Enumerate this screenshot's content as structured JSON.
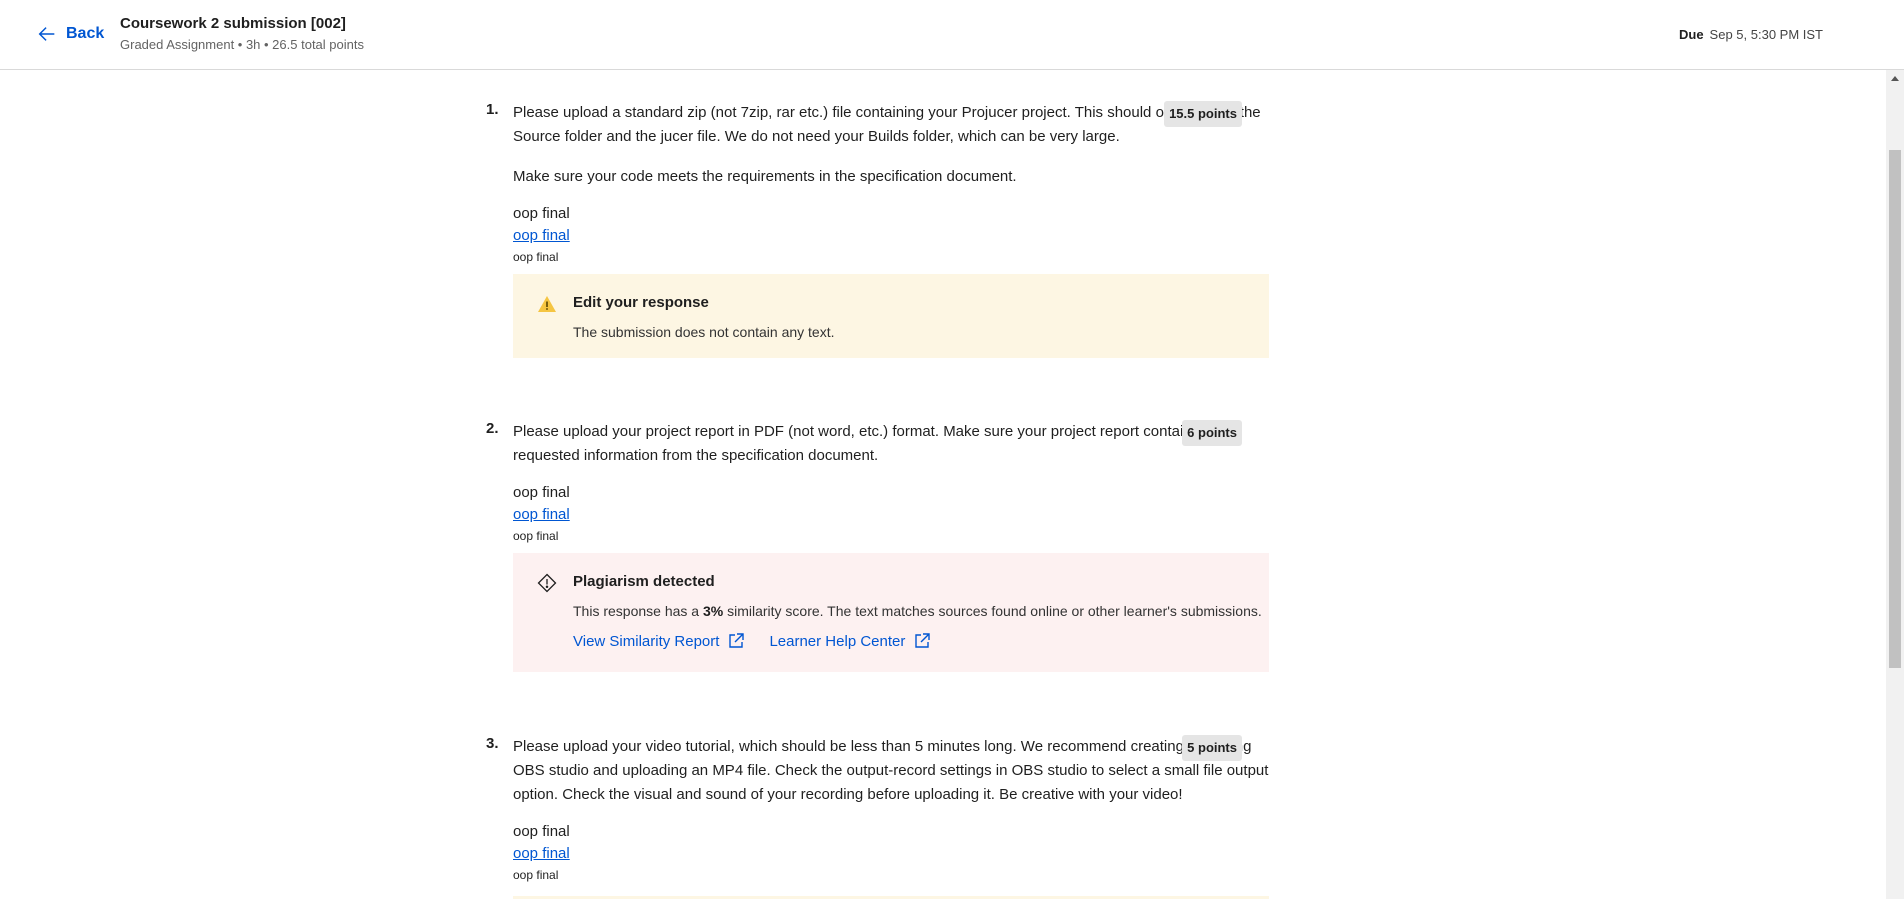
{
  "header": {
    "back_label": "Back",
    "title": "Coursework 2 submission [002]",
    "subtitle": "Graded Assignment • 3h • 26.5 total points",
    "due_label": "Due",
    "due_value": "Sep 5, 5:30 PM IST"
  },
  "questions": [
    {
      "number": "1.",
      "text": "Please upload a standard zip (not 7zip, rar etc.) file containing your Projucer project. This should only contain the Source folder and the jucer file. We do not need your Builds folder, which can be very large.",
      "extra": "Make sure your code meets the requirements in the specification document.",
      "points": "15.5 points",
      "file_name": "oop final",
      "file_link": "oop final",
      "file_small": "oop final",
      "alert": {
        "type": "warning",
        "icon": "warning-icon",
        "title": "Edit your response",
        "message": "The submission does not contain any text."
      }
    },
    {
      "number": "2.",
      "text": "Please upload your project report in PDF (not word, etc.) format. Make sure your project report contains the requested information from the specification document.",
      "points": "6 points",
      "file_name": "oop final",
      "file_link": "oop final",
      "file_small": "oop final",
      "alert": {
        "type": "plagiarism",
        "icon": "alert-diamond-icon",
        "title": "Plagiarism detected",
        "message_prefix": "This response has a ",
        "message_score": "3%",
        "message_suffix": " similarity score. The text matches sources found online or other learner's submissions.",
        "link1": "View Similarity Report",
        "link2": "Learner Help Center"
      }
    },
    {
      "number": "3.",
      "text": "Please upload your video tutorial, which should  be less than 5 minutes long. We recommend creating this using OBS studio and uploading an MP4 file. Check the output-record settings in OBS studio to select a small file output option. Check the visual and sound of your recording before uploading it. Be creative with your video!",
      "points": "5 points",
      "file_name": "oop final",
      "file_link": "oop final",
      "file_small": "oop final"
    }
  ],
  "colors": {
    "link": "#0056d2",
    "warning_bg": "#fdf6e3",
    "plagiarism_bg": "#fdf1f1",
    "points_bg": "#e5e5e5"
  }
}
